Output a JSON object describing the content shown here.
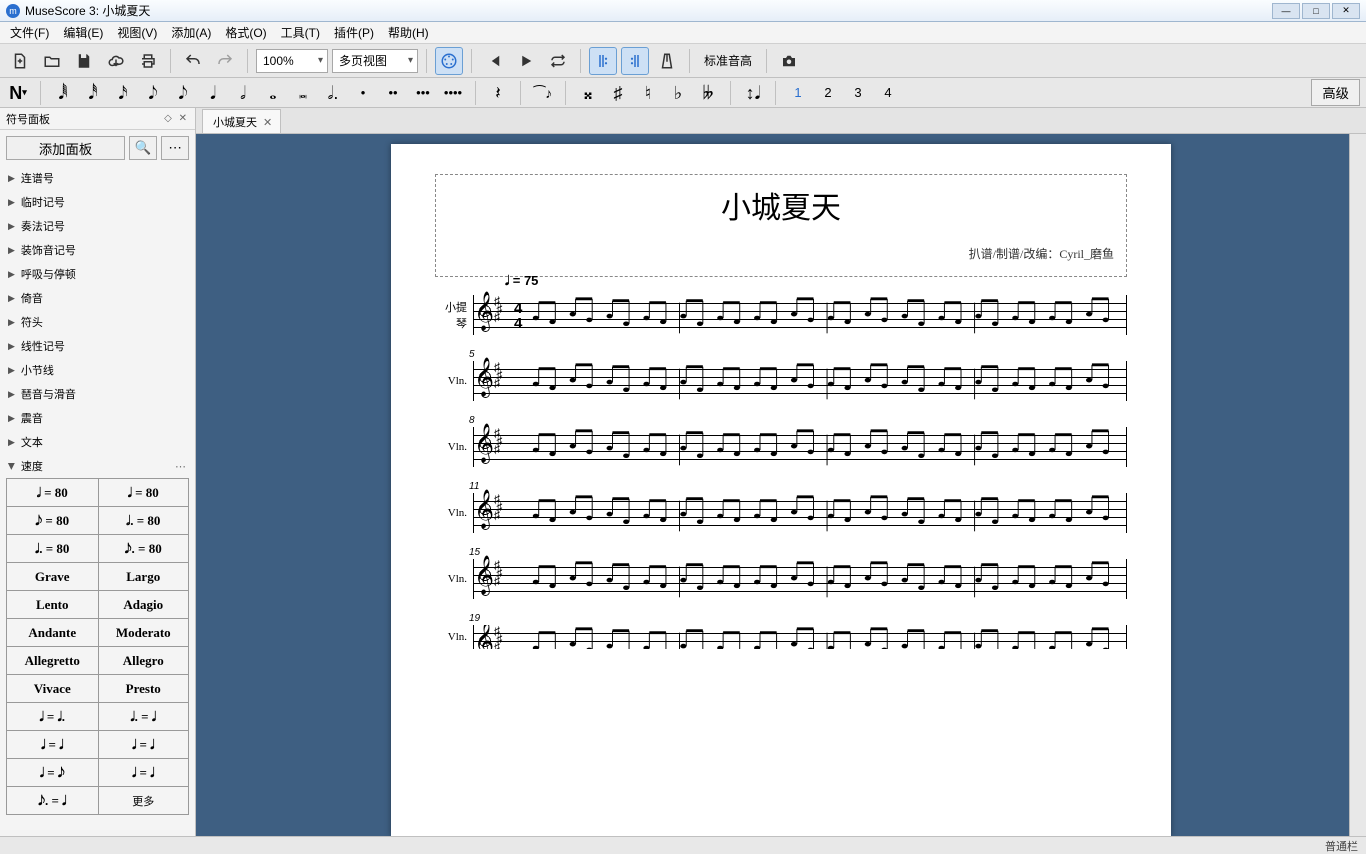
{
  "app": {
    "title": "MuseScore 3: 小城夏天"
  },
  "menu": [
    "文件(F)",
    "编辑(E)",
    "视图(V)",
    "添加(A)",
    "格式(O)",
    "工具(T)",
    "插件(P)",
    "帮助(H)"
  ],
  "toolbar": {
    "zoom": "100%",
    "viewmode": "多页视图",
    "pitch_label": "标准音高"
  },
  "noteinput": {
    "voices": [
      "1",
      "2",
      "3",
      "4"
    ],
    "advanced": "高级"
  },
  "palette": {
    "title": "符号面板",
    "add_btn": "添加面板",
    "categories": [
      "连谱号",
      "临时记号",
      "奏法记号",
      "装饰音记号",
      "呼吸与停顿",
      "倚音",
      "符头",
      "线性记号",
      "小节线",
      "琶音与滑音",
      "震音",
      "文本"
    ],
    "expanded": "速度",
    "tempo_cells": [
      "𝅗𝅥 = 80",
      "𝅘𝅥 = 80",
      "𝅘𝅥𝅮 = 80",
      "𝅗𝅥. = 80",
      "𝅘𝅥. = 80",
      "𝅘𝅥𝅮. = 80",
      "Grave",
      "Largo",
      "Lento",
      "Adagio",
      "Andante",
      "Moderato",
      "Allegretto",
      "Allegro",
      "Vivace",
      "Presto",
      "𝅘𝅥 = 𝅘𝅥.",
      "𝅘𝅥. = 𝅘𝅥",
      "𝅘𝅥 = 𝅘𝅥",
      "𝅘𝅥 = 𝅘𝅥",
      "𝅘𝅥 = 𝅘𝅥𝅮",
      "𝅘𝅥 = 𝅘𝅥",
      "𝅘𝅥𝅮. = 𝅘𝅥",
      "更多"
    ]
  },
  "tab": {
    "name": "小城夏天"
  },
  "score": {
    "title": "小城夏天",
    "subtitle": "扒谱/制谱/改编：Cyril_磨鱼",
    "tempo": "𝅘𝅥 = 75",
    "instrument_full": "小提琴",
    "instrument_short": "Vln.",
    "systems": [
      {
        "bar": "",
        "first": true
      },
      {
        "bar": "5"
      },
      {
        "bar": "8"
      },
      {
        "bar": "11"
      },
      {
        "bar": "15"
      },
      {
        "bar": "19",
        "partial": true
      }
    ],
    "key": "A major (3 sharps)",
    "time": "4/4"
  },
  "status": {
    "right": "普通栏"
  }
}
